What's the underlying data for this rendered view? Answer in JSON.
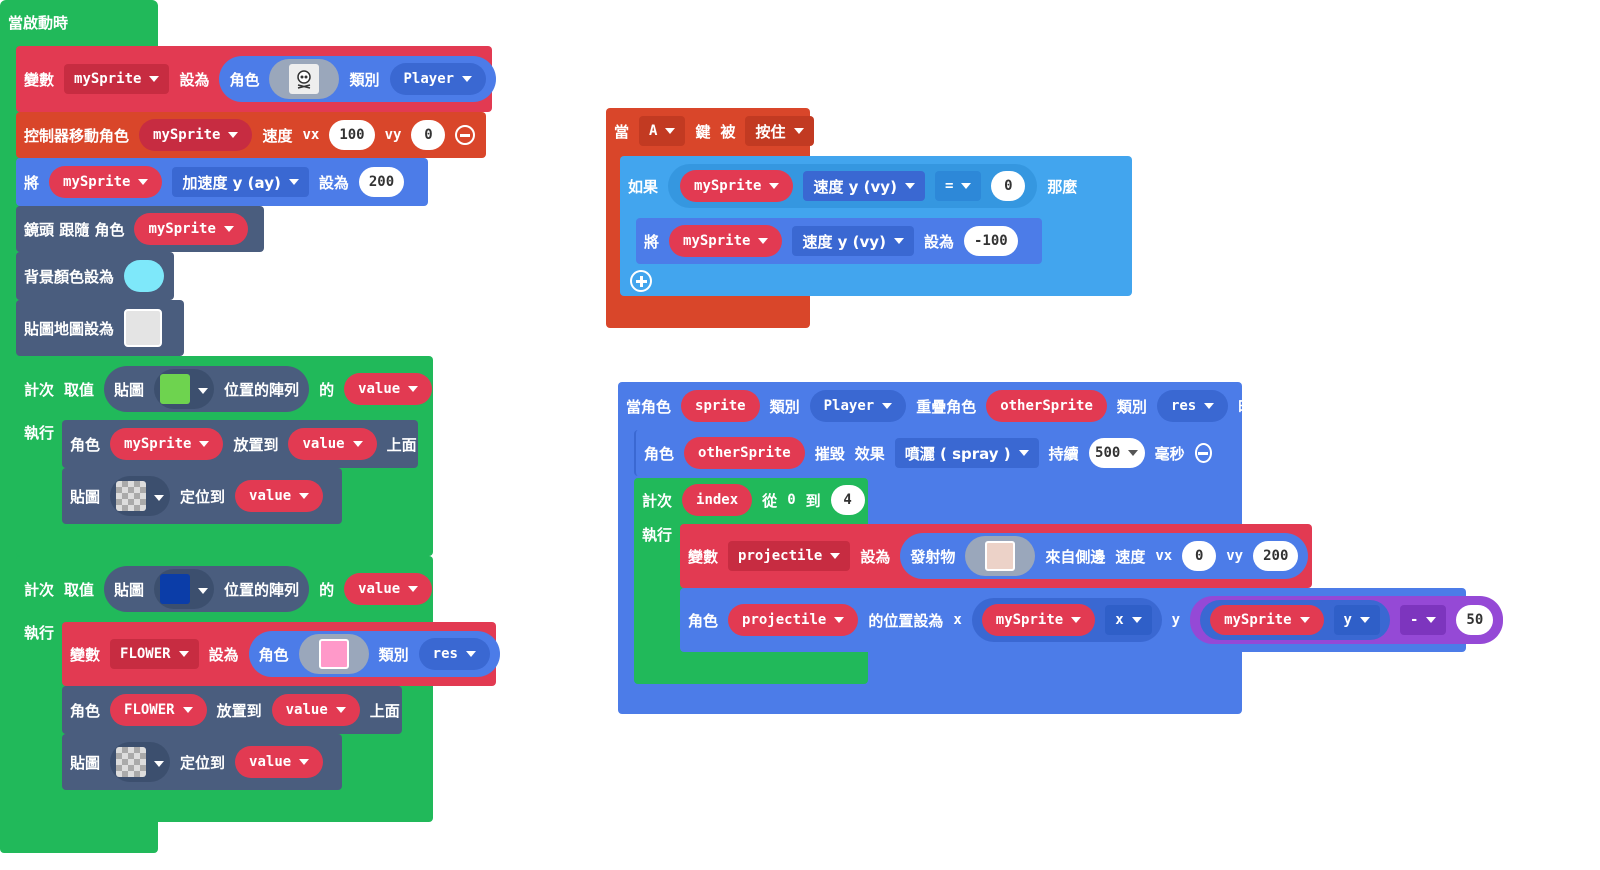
{
  "colors": {
    "loops": "#21b95a",
    "variables": "#e23a52",
    "controller": "#d9462a",
    "scene": "#4a5d7e",
    "sprites": "#4c7ce8",
    "logic": "#42a5ee",
    "math": "#9549d6"
  },
  "start_block": {
    "hat": "當啟動時",
    "set_var": {
      "label": "變數",
      "var": "mySprite",
      "set": "設為",
      "sprite_label": "角色",
      "kind_label": "類別",
      "kind": "Player"
    },
    "controller": {
      "label": "控制器移動角色",
      "var": "mySprite",
      "speed": "速度",
      "vx_label": "vx",
      "vx": "100",
      "vy_label": "vy",
      "vy": "0"
    },
    "set_accel": {
      "label": "將",
      "var": "mySprite",
      "prop": "加速度 y (ay)",
      "set": "設為",
      "value": "200"
    },
    "camera": {
      "label": "鏡頭 跟隨 角色",
      "var": "mySprite"
    },
    "bg": {
      "label": "背景顏色設為",
      "color": "#7ee8fa"
    },
    "tilemap": {
      "label": "貼圖地圖設為"
    },
    "loop1": {
      "for": "計次",
      "take": "取值",
      "tile": "貼圖",
      "tile_color": "#6ed34f",
      "pos": "位置的陣列",
      "of": "的",
      "item": "value",
      "do": "執行",
      "place": {
        "sprite": "角色",
        "var": "mySprite",
        "put": "放置到",
        "target": "value",
        "on": "上面"
      },
      "setTile": {
        "tile": "貼圖",
        "locate": "定位到",
        "target": "value"
      }
    },
    "loop2": {
      "for": "計次",
      "take": "取值",
      "tile": "貼圖",
      "tile_color": "#0b3da8",
      "pos": "位置的陣列",
      "of": "的",
      "item": "value",
      "do": "執行",
      "set_var": {
        "label": "變數",
        "var": "FLOWER",
        "set": "設為",
        "sprite_label": "角色",
        "kind_label": "類別",
        "kind": "res"
      },
      "place": {
        "sprite": "角色",
        "var": "FLOWER",
        "put": "放置到",
        "target": "value",
        "on": "上面"
      },
      "setTile": {
        "tile": "貼圖",
        "locate": "定位到",
        "target": "value"
      }
    }
  },
  "button_block": {
    "when": "當",
    "key": "A",
    "key_label": "鍵",
    "passive": "被",
    "action": "按住",
    "if": {
      "label": "如果",
      "var": "mySprite",
      "prop": "速度 y (vy)",
      "op": "=",
      "value": "0",
      "then": "那麼"
    },
    "set": {
      "label": "將",
      "var": "mySprite",
      "prop": "速度 y (vy)",
      "set": "設為",
      "value": "-100"
    }
  },
  "overlap_block": {
    "when": "當角色",
    "sprite": "sprite",
    "kind_label": "類別",
    "kind": "Player",
    "overlap": "重疊角色",
    "other": "otherSprite",
    "kind2": "res",
    "time": "時",
    "destroy": {
      "label": "角色",
      "var": "otherSprite",
      "destroy": "摧毀",
      "effect_label": "效果",
      "effect": "噴灑 ( spray )",
      "for": "持續",
      "ms": "500",
      "unit": "毫秒"
    },
    "for": {
      "label": "計次",
      "index": "index",
      "from": "從",
      "start": "0",
      "to": "到",
      "end": "4",
      "do": "執行"
    },
    "projectile": {
      "label": "變數",
      "var": "projectile",
      "set": "設為",
      "shoot": "發射物",
      "from": "來自側邊",
      "speed": "速度",
      "vx_label": "vx",
      "vx": "0",
      "vy_label": "vy",
      "vy": "200"
    },
    "setpos": {
      "label": "角色",
      "var": "projectile",
      "pos": "的位置設為",
      "x_label": "x",
      "var_x": "mySprite",
      "prop_x": "x",
      "y_label": "y",
      "var_y": "mySprite",
      "prop_y": "y",
      "op": "-",
      "value": "50"
    }
  }
}
